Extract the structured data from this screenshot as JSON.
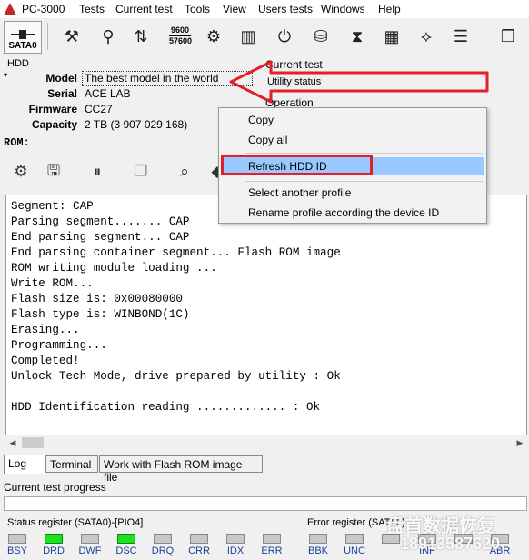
{
  "app": {
    "title": "PC-3000"
  },
  "menu": [
    "Tests",
    "Current test",
    "Tools",
    "View",
    "Users tests",
    "Windows",
    "Help"
  ],
  "toolbar": {
    "sata_label": "SATA0",
    "speed_top": "9600",
    "speed_bottom": "57600"
  },
  "hdd": {
    "group_label": "HDD",
    "fields": [
      {
        "name": "Model",
        "value": "The best model in the world"
      },
      {
        "name": "Serial",
        "value": "ACE LAB"
      },
      {
        "name": "Firmware",
        "value": "CC27"
      },
      {
        "name": "Capacity",
        "value": "2 TB (3 907 029 168)"
      }
    ]
  },
  "current_test": {
    "group_label": "Current test",
    "utility_status": "Utility status",
    "operation_label": "Operation"
  },
  "rom": {
    "label": "ROM:"
  },
  "log_lines": [
    "Segment: CAP",
    "Parsing segment....... CAP",
    "End parsing segment... CAP",
    "End parsing container segment... Flash ROM image",
    "ROM writing module loading ...",
    "Write ROM...",
    "Flash size is: 0x00080000",
    "Flash type is: WINBOND(1C)",
    "Erasing...",
    "Programming...",
    "Completed!",
    "Unlock Tech Mode, drive prepared by utility : Ok",
    "",
    "HDD Identification reading ............. : Ok"
  ],
  "tabs": [
    "Log",
    "Terminal",
    "Work with Flash ROM image file"
  ],
  "progress": {
    "label": "Current test progress"
  },
  "status_register": {
    "label": "Status register (SATA0)-[PIO4]",
    "leds": [
      {
        "name": "BSY",
        "on": false
      },
      {
        "name": "DRD",
        "on": true
      },
      {
        "name": "DWF",
        "on": false
      },
      {
        "name": "DSC",
        "on": true
      },
      {
        "name": "DRQ",
        "on": false
      },
      {
        "name": "CRR",
        "on": false
      },
      {
        "name": "IDX",
        "on": false
      },
      {
        "name": "ERR",
        "on": false
      }
    ]
  },
  "error_register": {
    "label": "Error register (SATA0)",
    "leds": [
      {
        "name": "BBK",
        "on": false
      },
      {
        "name": "UNC",
        "on": false
      },
      {
        "name": "",
        "on": false
      },
      {
        "name": "INF",
        "on": false
      },
      {
        "name": "",
        "on": false
      },
      {
        "name": "ABR",
        "on": false
      }
    ]
  },
  "context_menu": {
    "items": [
      "Copy",
      "Copy all",
      "Refresh HDD ID",
      "Select another profile",
      "Rename profile according the device ID"
    ],
    "highlighted": "Refresh HDD ID"
  },
  "watermark": {
    "line1": "盘首数据恢复",
    "line2": "18913587620"
  },
  "colors": {
    "annotation_red": "#e0202a",
    "highlight": "#99c9ff",
    "led_on": "#1ee01e"
  }
}
